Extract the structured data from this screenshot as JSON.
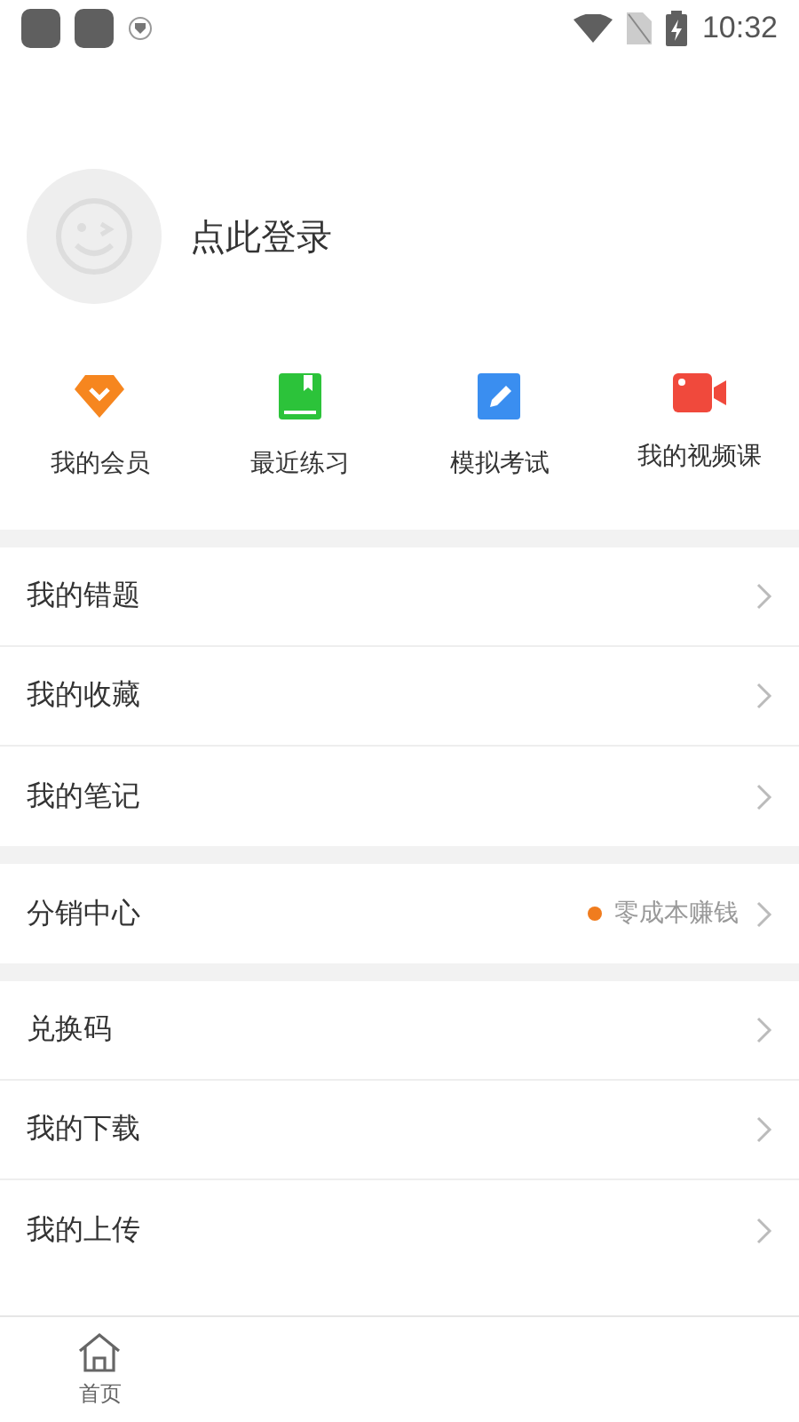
{
  "status_bar": {
    "time": "10:32"
  },
  "profile": {
    "login_label": "点此登录"
  },
  "shortcuts": [
    {
      "label": "我的会员",
      "kind": "vip"
    },
    {
      "label": "最近练习",
      "kind": "book"
    },
    {
      "label": "模拟考试",
      "kind": "exam"
    },
    {
      "label": "我的视频课",
      "kind": "video"
    }
  ],
  "menu_groups": [
    [
      {
        "label": "我的错题"
      },
      {
        "label": "我的收藏"
      },
      {
        "label": "我的笔记"
      }
    ],
    [
      {
        "label": "分销中心",
        "badge": "零成本赚钱",
        "color": "#f07c1e"
      }
    ],
    [
      {
        "label": "兑换码"
      },
      {
        "label": "我的下载"
      },
      {
        "label": "我的上传"
      }
    ]
  ],
  "tab_bar": [
    {
      "label": "首页",
      "selected": false
    }
  ]
}
